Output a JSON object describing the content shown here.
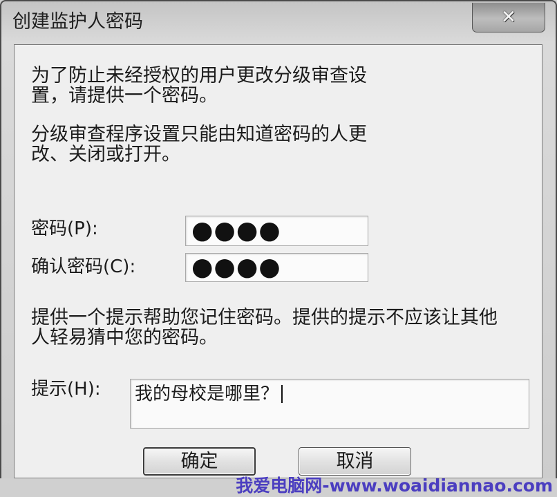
{
  "window": {
    "title": "创建监护人密码",
    "close_icon": "close-icon"
  },
  "intro": {
    "lines": [
      "为了防止未经授权的用户更改分级审查设",
      "置，请提供一个密码。"
    ]
  },
  "info": {
    "lines": [
      "分级审查程序设置只能由知道密码的人更",
      "改、关闭或打开。"
    ]
  },
  "password": {
    "label": "密码(P):",
    "masked_value": "●●●●"
  },
  "confirm_password": {
    "label": "确认密码(C):",
    "masked_value": "●●●●"
  },
  "hint_note": {
    "lines": [
      "提供一个提示帮助您记住密码。提供的提示不应该让其他",
      "人轻易猜中您的密码。"
    ]
  },
  "hint": {
    "label": "提示(H):",
    "value": "我的母校是哪里？"
  },
  "buttons": {
    "ok": "确定",
    "cancel": "取消"
  },
  "watermark": "我爱电脑网-www.woaidiannao.com",
  "colors": {
    "panel_background": "#efefef",
    "watermark": "#4b3ec0"
  }
}
